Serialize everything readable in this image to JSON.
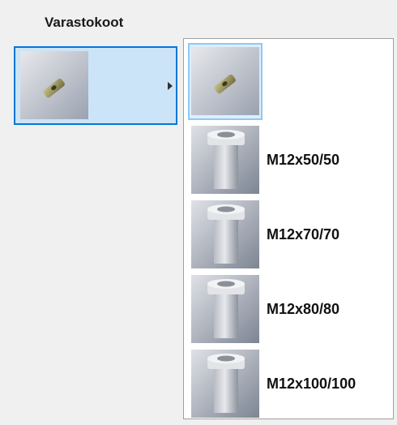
{
  "header": {
    "title": "Varastokoot"
  },
  "dropdown": {
    "items": [
      {
        "label": "M12x50/50",
        "icon": "bushing-icon"
      },
      {
        "label": "M12x70/70",
        "icon": "bushing-icon"
      },
      {
        "label": "M12x80/80",
        "icon": "bushing-icon"
      },
      {
        "label": "M12x100/100",
        "icon": "bushing-icon"
      }
    ]
  },
  "colors": {
    "selection_fill": "#cce4f7",
    "selection_border": "#0078d7"
  }
}
